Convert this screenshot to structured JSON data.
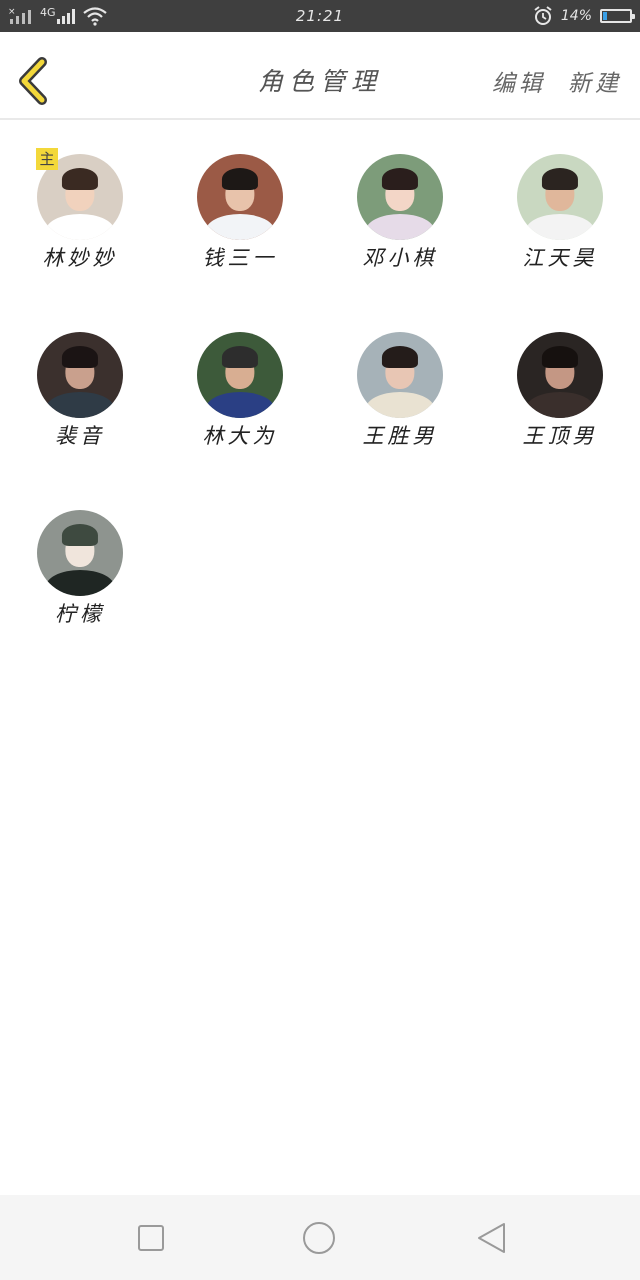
{
  "status_bar": {
    "network_label": "4G",
    "time": "21:21",
    "battery_text": "14%",
    "battery_level": 0.14
  },
  "header": {
    "title": "角色管理",
    "edit_label": "编辑",
    "new_label": "新建"
  },
  "characters": [
    {
      "name": "林妙妙",
      "badge": "主",
      "avatar_colors": {
        "bg": "#d9cfc4",
        "hair": "#3a2a22",
        "face": "#f1d2bd",
        "body": "#ffffff"
      }
    },
    {
      "name": "钱三一",
      "avatar_colors": {
        "bg": "#9b5a46",
        "hair": "#1d1816",
        "face": "#e8c3ab",
        "body": "#f2f4f7"
      }
    },
    {
      "name": "邓小棋",
      "avatar_colors": {
        "bg": "#7d9c7a",
        "hair": "#2a1e1c",
        "face": "#f3d6c7",
        "body": "#e6dbe8"
      }
    },
    {
      "name": "江天昊",
      "avatar_colors": {
        "bg": "#c9d8c1",
        "hair": "#2b2420",
        "face": "#e0b79b",
        "body": "#f3f3f3"
      }
    },
    {
      "name": "裴音",
      "avatar_colors": {
        "bg": "#3b302d",
        "hair": "#1b1414",
        "face": "#c9a08d",
        "body": "#2f3b46"
      }
    },
    {
      "name": "林大为",
      "avatar_colors": {
        "bg": "#3d5a3a",
        "hair": "#2d2d2d",
        "face": "#d8ae92",
        "body": "#2a3f84"
      }
    },
    {
      "name": "王胜男",
      "avatar_colors": {
        "bg": "#a6b2b8",
        "hair": "#241c1a",
        "face": "#e8c6b4",
        "body": "#e9e2d2"
      }
    },
    {
      "name": "王顶男",
      "avatar_colors": {
        "bg": "#2a2523",
        "hair": "#16110f",
        "face": "#c49784",
        "body": "#3a2f2c"
      }
    },
    {
      "name": "柠檬",
      "avatar_colors": {
        "bg": "#8e948f",
        "hair": "#3e4a40",
        "face": "#f0e5dc",
        "body": "#1f2623"
      }
    }
  ],
  "icons": {
    "back": "chevron-left-icon",
    "recent": "square-icon",
    "home": "circle-icon",
    "back_nav": "triangle-left-icon"
  },
  "colors": {
    "accent": "#f3d83a",
    "statusbar": "#3f3f3f"
  }
}
